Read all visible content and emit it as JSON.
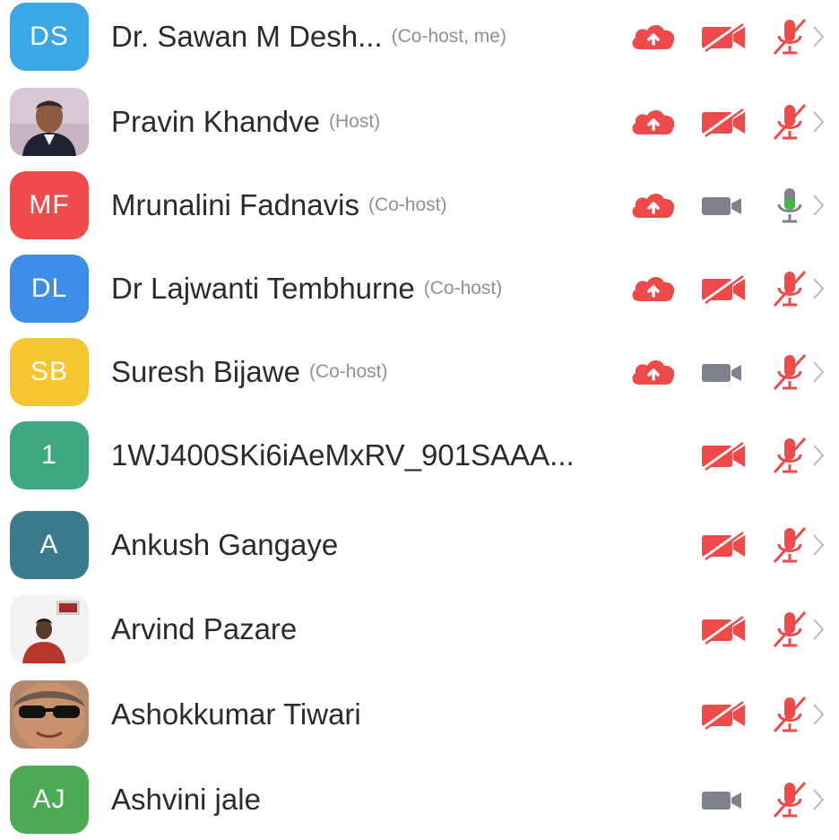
{
  "colors": {
    "red": "#ef4a4a",
    "gray_cam": "#7f828c",
    "green_mic": "#43b649",
    "name": "#2b2b2b",
    "role": "#8f8f9a"
  },
  "participants": [
    {
      "initials": "DS",
      "avatar_color": "#3aa7e6",
      "name": "Dr. Sawan M Desh...",
      "role": "(Co-host, me)",
      "cloud": true,
      "video": "off",
      "mic": "muted"
    },
    {
      "initials": "",
      "avatar_type": "photo",
      "name": "Pravin Khandve",
      "role": "(Host)",
      "cloud": true,
      "video": "off",
      "mic": "muted"
    },
    {
      "initials": "MF",
      "avatar_color": "#f04a4a",
      "name": "Mrunalini Fadnavis",
      "role": "(Co-host)",
      "cloud": true,
      "video": "on",
      "mic": "active"
    },
    {
      "initials": "DL",
      "avatar_color": "#3d8ee8",
      "name": "Dr Lajwanti Tembhurne",
      "role": "(Co-host)",
      "cloud": true,
      "video": "off",
      "mic": "muted"
    },
    {
      "initials": "SB",
      "avatar_color": "#f7c531",
      "name": "Suresh Bijawe",
      "role": "(Co-host)",
      "cloud": true,
      "video": "on",
      "mic": "muted"
    },
    {
      "initials": "1",
      "avatar_color": "#3ea87e",
      "name": "1WJ400SKi6iAeMxRV_901SAAA...",
      "role": "",
      "cloud": false,
      "video": "off",
      "mic": "muted"
    },
    {
      "initials": "A",
      "avatar_color": "#3a7a8c",
      "name": "Ankush Gangaye",
      "role": "",
      "cloud": false,
      "video": "off",
      "mic": "muted"
    },
    {
      "initials": "",
      "avatar_type": "photo",
      "name": "Arvind Pazare",
      "role": "",
      "cloud": false,
      "video": "off",
      "mic": "muted"
    },
    {
      "initials": "",
      "avatar_type": "photo",
      "name": "Ashokkumar Tiwari",
      "role": "",
      "cloud": false,
      "video": "off",
      "mic": "muted"
    },
    {
      "initials": "AJ",
      "avatar_color": "#4caa54",
      "name": "Ashvini jale",
      "role": "",
      "cloud": false,
      "video": "on",
      "mic": "muted"
    }
  ]
}
